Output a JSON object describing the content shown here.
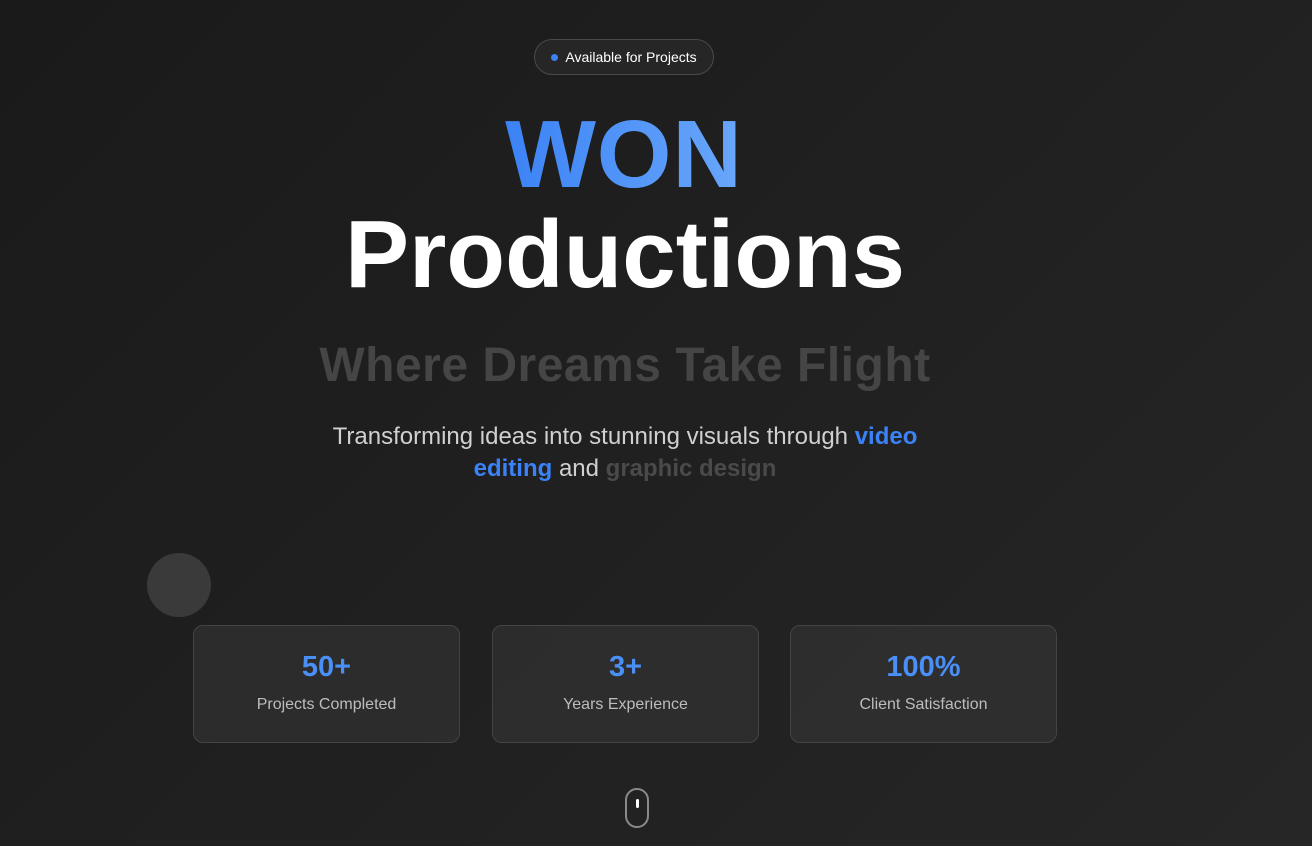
{
  "badge": {
    "label": "Available for Projects",
    "dot_color": "#3b82f6"
  },
  "hero": {
    "title_accent": "WON",
    "title_main": "Productions",
    "tagline": "Where Dreams Take Flight",
    "description": {
      "part1": "Transforming ideas into stunning visuals through ",
      "highlight1": "video editing",
      "part2": " and ",
      "highlight2": "graphic design"
    }
  },
  "stats": [
    {
      "value": "50+",
      "label": "Projects Completed"
    },
    {
      "value": "3+",
      "label": "Years Experience"
    },
    {
      "value": "100%",
      "label": "Client Satisfaction"
    }
  ],
  "colors": {
    "accent": "#3b82f6",
    "background": "#1f1f1f",
    "muted_text": "#454545"
  },
  "icons": {
    "scroll_indicator": "mouse-scroll-icon"
  }
}
